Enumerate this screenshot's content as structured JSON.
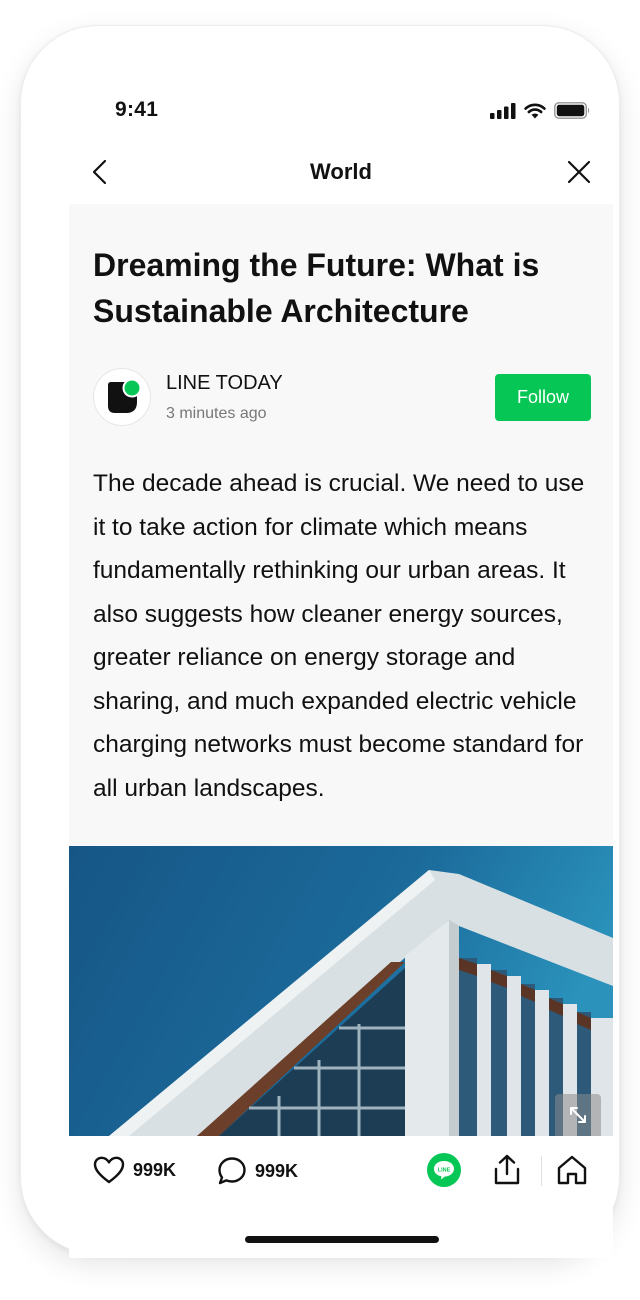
{
  "status_bar": {
    "time": "9:41",
    "icons": [
      "cellular-signal-icon",
      "wifi-icon",
      "battery-icon"
    ]
  },
  "nav": {
    "title": "World",
    "back_icon": "chevron-left-icon",
    "close_icon": "close-icon"
  },
  "article": {
    "headline": "Dreaming the Future: What is Sustainable Architecture",
    "publisher": {
      "name": "LINE TODAY",
      "time": "3 minutes ago",
      "follow_label": "Follow"
    },
    "body": "The decade ahead is crucial. We need to use it to take action for climate which means fundamentally rethinking our urban areas. It also suggests how cleaner energy sources, greater reliance on energy storage and sharing, and much expanded electric vehicle charging networks must become standard for all urban landscapes."
  },
  "actions": {
    "likes": "999K",
    "comments": "999K",
    "icons": [
      "heart-icon",
      "comment-icon",
      "line-share-icon",
      "share-icon",
      "home-icon"
    ],
    "line_badge": "LINE"
  },
  "colors": {
    "accent": "#06c755",
    "article_bg": "#f8f8f8",
    "sky": "#1b6a9a"
  }
}
